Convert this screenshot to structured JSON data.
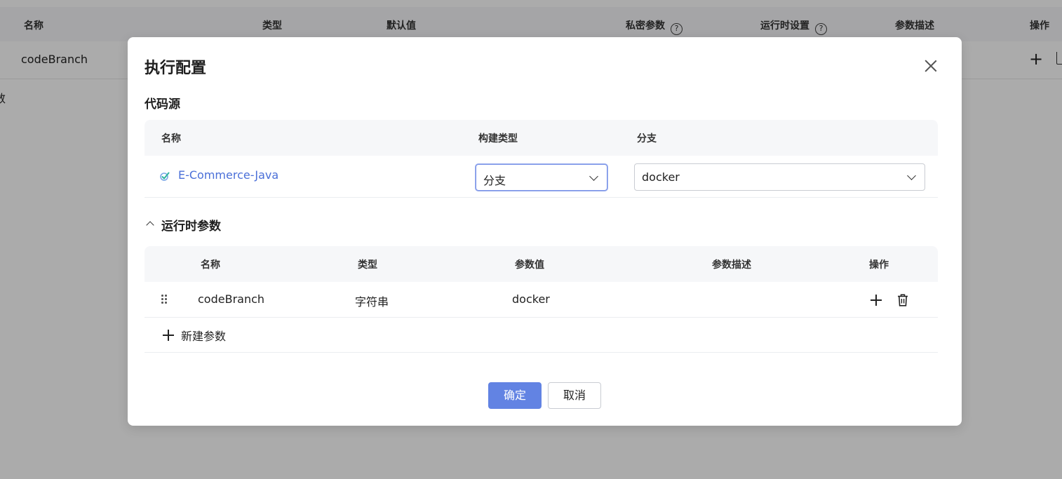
{
  "background": {
    "headers": [
      "名称",
      "类型",
      "默认值",
      "私密参数",
      "运行时设置",
      "参数描述",
      "操作"
    ],
    "help_glyph": "?",
    "row": {
      "name": "codeBranch"
    },
    "row2_text": "数"
  },
  "modal": {
    "title": "执行配置",
    "code_source": {
      "title": "代码源",
      "columns": [
        "名称",
        "构建类型",
        "分支"
      ],
      "row": {
        "name": "E-Commerce-Java",
        "build_type": "分支",
        "branch": "docker"
      }
    },
    "runtime_params": {
      "title": "运行时参数",
      "columns": [
        "名称",
        "类型",
        "参数值",
        "参数描述",
        "操作"
      ],
      "rows": [
        {
          "name": "codeBranch",
          "type": "字符串",
          "value": "docker",
          "description": ""
        }
      ],
      "add_label": "新建参数"
    },
    "buttons": {
      "confirm": "确定",
      "cancel": "取消"
    }
  },
  "colors": {
    "primary": "#6283e3",
    "link": "#4a6fd8",
    "overlay": "rgba(0,0,0,0.33)",
    "table_header_bg": "#f6f7f9"
  }
}
